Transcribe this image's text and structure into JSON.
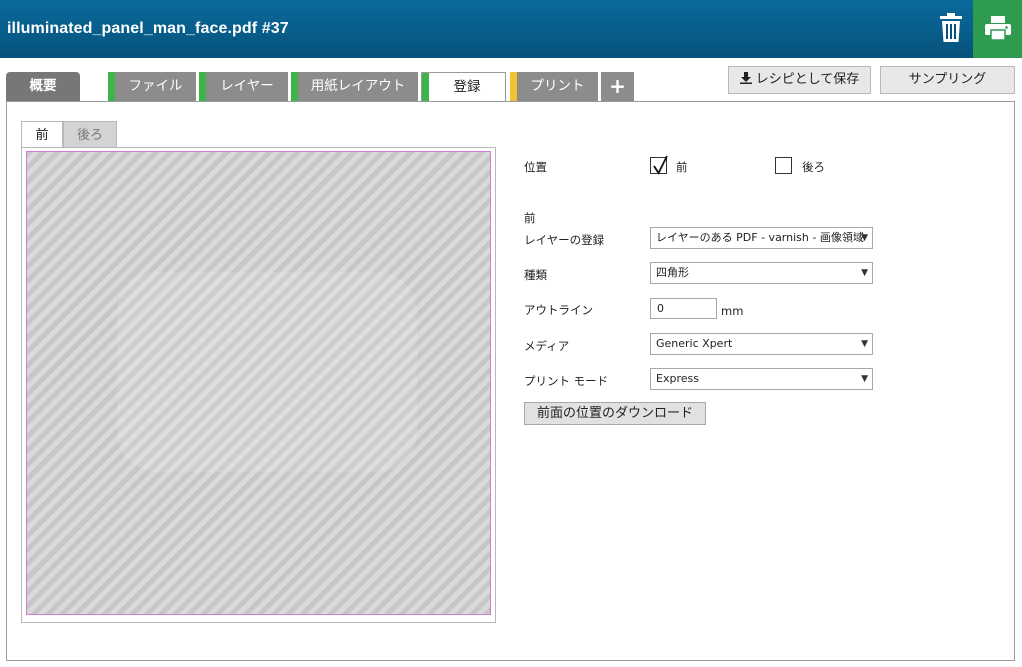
{
  "header": {
    "title": "illuminated_panel_man_face.pdf #37",
    "trash_icon": "trash-icon",
    "print_icon": "printer-icon",
    "print_bg": "#2e9b4f"
  },
  "tabs": [
    {
      "label": "概要",
      "status": "none"
    },
    {
      "label": "ファイル",
      "status": "#3cb44b"
    },
    {
      "label": "レイヤー",
      "status": "#3cb44b"
    },
    {
      "label": "用紙レイアウト",
      "status": "#3cb44b"
    },
    {
      "label": "登録",
      "status": "#3cb44b",
      "active": true
    },
    {
      "label": "プリント",
      "status": "#f2c232"
    },
    {
      "label": "+",
      "status": "none"
    }
  ],
  "actions": {
    "save_recipe": "レシピとして保存",
    "sampling": "サンプリング"
  },
  "preview": {
    "tab_front": "前",
    "tab_back": "後ろ"
  },
  "form": {
    "position_label": "位置",
    "front_label": "前",
    "front_checked": true,
    "back_label": "後ろ",
    "back_checked": false,
    "section_title": "前",
    "layer_reg_label": "レイヤーの登録",
    "layer_reg_value": "レイヤーのある PDF - varnish - 画像領域",
    "type_label": "種類",
    "type_value": "四角形",
    "outline_label": "アウトライン",
    "outline_value": "0",
    "outline_unit": "mm",
    "media_label": "メディア",
    "media_value": "Generic Xpert",
    "print_mode_label": "プリント モード",
    "print_mode_value": "Express",
    "download_button": "前面の位置のダウンロード"
  }
}
